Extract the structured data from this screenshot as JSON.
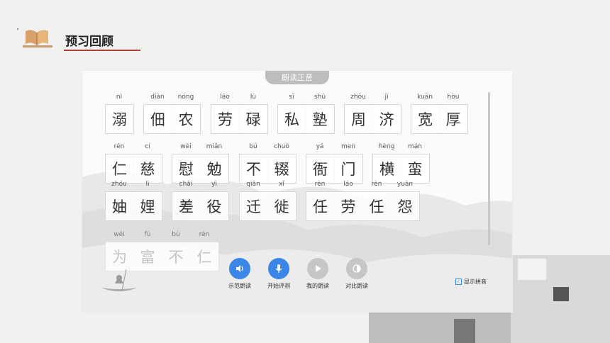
{
  "header": {
    "title": "预习回顾",
    "accent_color": "#b04030"
  },
  "panel": {
    "tab_title": "朗读正音",
    "rows": [
      [
        {
          "chars": [
            {
              "py": "nì",
              "ch": "溺"
            }
          ]
        },
        {
          "chars": [
            {
              "py": "diàn",
              "ch": "佃"
            },
            {
              "py": "nóng",
              "ch": "农"
            }
          ]
        },
        {
          "chars": [
            {
              "py": "láo",
              "ch": "劳"
            },
            {
              "py": "lù",
              "ch": "碌"
            }
          ]
        },
        {
          "chars": [
            {
              "py": "sī",
              "ch": "私"
            },
            {
              "py": "shú",
              "ch": "塾"
            }
          ]
        },
        {
          "chars": [
            {
              "py": "zhōu",
              "ch": "周"
            },
            {
              "py": "jì",
              "ch": "济"
            }
          ]
        },
        {
          "chars": [
            {
              "py": "kuān",
              "ch": "宽"
            },
            {
              "py": "hòu",
              "ch": "厚"
            }
          ]
        }
      ],
      [
        {
          "chars": [
            {
              "py": "rén",
              "ch": "仁"
            },
            {
              "py": "cí",
              "ch": "慈"
            }
          ]
        },
        {
          "chars": [
            {
              "py": "wèi",
              "ch": "慰"
            },
            {
              "py": "miǎn",
              "ch": "勉"
            }
          ]
        },
        {
          "chars": [
            {
              "py": "bú",
              "ch": "不"
            },
            {
              "py": "chuò",
              "ch": "辍"
            }
          ]
        },
        {
          "chars": [
            {
              "py": "yá",
              "ch": "衙"
            },
            {
              "py": "men",
              "ch": "门"
            }
          ]
        },
        {
          "chars": [
            {
              "py": "hèng",
              "ch": "横"
            },
            {
              "py": "mán",
              "ch": "蛮"
            }
          ]
        }
      ],
      [
        {
          "chars": [
            {
              "py": "zhóu",
              "ch": "妯"
            },
            {
              "py": "li",
              "ch": "娌"
            }
          ]
        },
        {
          "chars": [
            {
              "py": "chāi",
              "ch": "差"
            },
            {
              "py": "yì",
              "ch": "役"
            }
          ]
        },
        {
          "chars": [
            {
              "py": "qiān",
              "ch": "迁"
            },
            {
              "py": "xǐ",
              "ch": "徙"
            }
          ]
        },
        {
          "chars": [
            {
              "py": "rèn",
              "ch": "任"
            },
            {
              "py": "láo",
              "ch": "劳"
            },
            {
              "py": "rèn",
              "ch": "任"
            },
            {
              "py": "yuàn",
              "ch": "怨"
            }
          ]
        }
      ],
      [
        {
          "chars": [
            {
              "py": "wéi",
              "ch": "为"
            },
            {
              "py": "fù",
              "ch": "富"
            },
            {
              "py": "bù",
              "ch": "不"
            },
            {
              "py": "rén",
              "ch": "仁"
            }
          ]
        }
      ]
    ],
    "controls": [
      {
        "label": "示范朗读",
        "icon": "speaker-icon",
        "color": "#3b86e6"
      },
      {
        "label": "开始评测",
        "icon": "microphone-icon",
        "color": "#3b86e6"
      },
      {
        "label": "我的朗读",
        "icon": "play-icon",
        "color": "#c6c6c6"
      },
      {
        "label": "对比朗读",
        "icon": "compare-icon",
        "color": "#c6c6c6"
      }
    ],
    "show_pinyin": {
      "label": "显示拼音",
      "checked": true
    }
  }
}
